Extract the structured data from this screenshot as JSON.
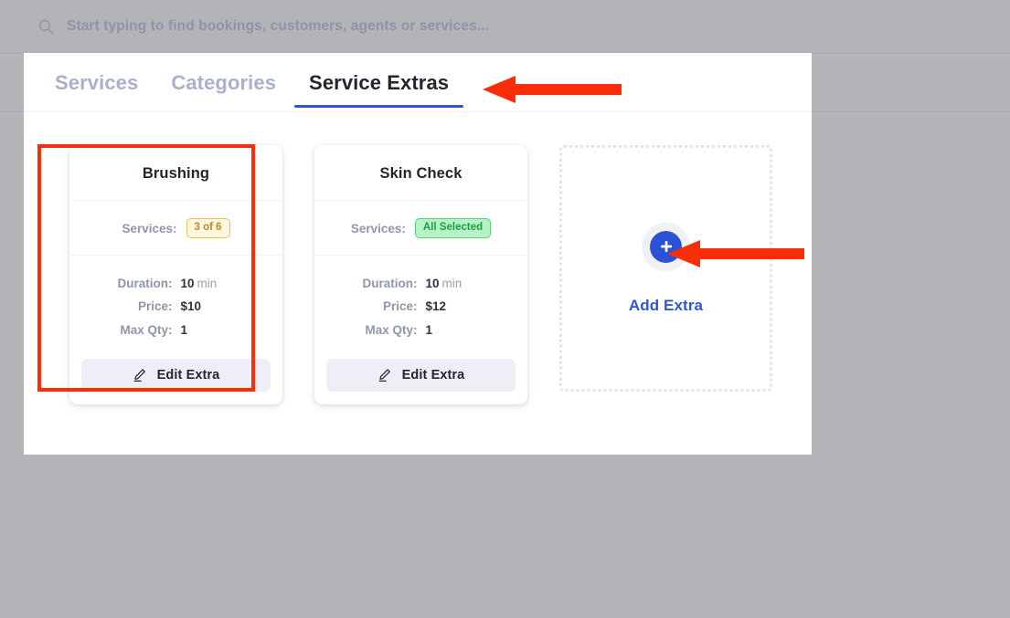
{
  "background": {
    "search_placeholder": "Start typing to find bookings, customers, agents or services...",
    "search_icon": "search-icon"
  },
  "panel": {
    "tabs": [
      {
        "label": "Services",
        "active": false
      },
      {
        "label": "Categories",
        "active": false
      },
      {
        "label": "Service Extras",
        "active": true
      }
    ],
    "extras": [
      {
        "title": "Brushing",
        "services_label": "Services:",
        "services_badge": "3 of 6",
        "badge_style": "amber",
        "specs": [
          {
            "key": "Duration:",
            "value": "10",
            "unit": "min"
          },
          {
            "key": "Price:",
            "value": "$10",
            "unit": ""
          },
          {
            "key": "Max Qty:",
            "value": "1",
            "unit": ""
          }
        ],
        "edit_label": "Edit Extra",
        "edit_icon": "pencil-icon"
      },
      {
        "title": "Skin Check",
        "services_label": "Services:",
        "services_badge": "All Selected",
        "badge_style": "green",
        "specs": [
          {
            "key": "Duration:",
            "value": "10",
            "unit": "min"
          },
          {
            "key": "Price:",
            "value": "$12",
            "unit": ""
          },
          {
            "key": "Max Qty:",
            "value": "1",
            "unit": ""
          }
        ],
        "edit_label": "Edit Extra",
        "edit_icon": "pencil-icon"
      }
    ],
    "add_card": {
      "label": "Add Extra",
      "icon": "plus-icon"
    }
  },
  "annotations": {
    "highlight_rect_target": "Brushing extra card",
    "arrow_1_target": "Service Extras tab",
    "arrow_2_target": "Add Extra button",
    "color": "#f92e09"
  },
  "colors": {
    "accent_blue": "#2f55d4",
    "plus_blue": "#2b52d6",
    "badge_amber_text": "#c08a1e",
    "badge_amber_bg": "#fdf5dd",
    "badge_green_text": "#1f9d4a",
    "badge_green_bg": "#b6f2c5",
    "text_dark": "#23262f",
    "text_muted": "#8f96ab",
    "overlay_gray": "#b3b4b7",
    "annotation_red": "#f92e09"
  }
}
